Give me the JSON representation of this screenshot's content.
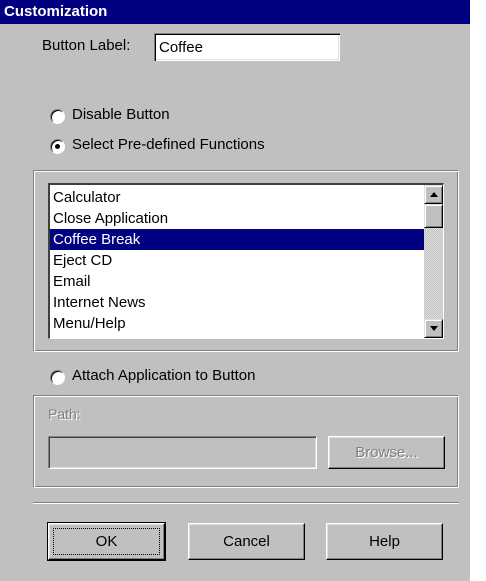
{
  "window": {
    "title": "Customization"
  },
  "button_label": {
    "label": "Button Label:",
    "value": "Coffee"
  },
  "options": {
    "disable_button": "Disable Button",
    "predefined_functions": "Select Pre-defined Functions",
    "attach_application": "Attach Application to Button",
    "selected": "predefined_functions"
  },
  "functions_list": {
    "items": [
      "Calculator",
      "Close Application",
      "Coffee Break",
      "Eject CD",
      "Email",
      "Internet News",
      "Menu/Help"
    ],
    "selected_index": 2
  },
  "application": {
    "path_label": "Path:",
    "path_value": "",
    "browse_label": "Browse..."
  },
  "footer": {
    "ok_label": "OK",
    "cancel_label": "Cancel",
    "help_label": "Help"
  }
}
